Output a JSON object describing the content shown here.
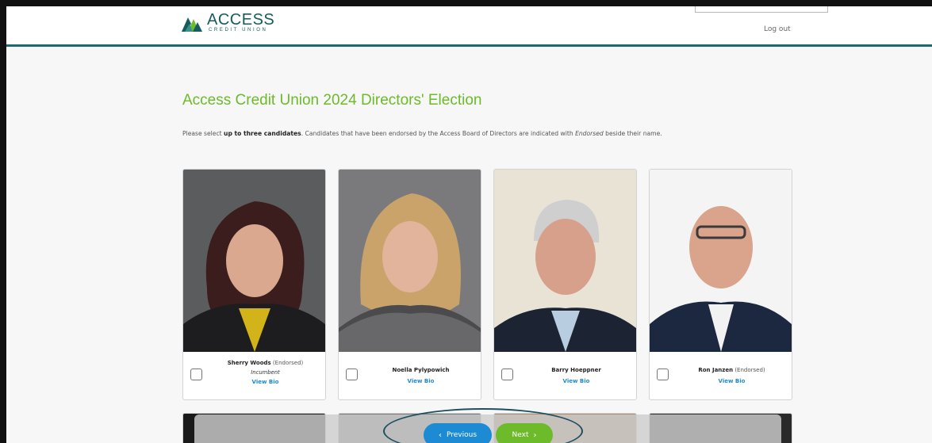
{
  "header": {
    "logo_word": "ACCESS",
    "logo_sub": "CREDIT UNION",
    "logout": "Log out"
  },
  "page": {
    "title": "Access Credit Union 2024 Directors' Election",
    "instructions_pre": "Please select ",
    "instructions_bold": "up to three candidates",
    "instructions_mid": ". Candidates that have been endorsed by the Access Board of Directors are indicated with ",
    "instructions_em": "Endorsed",
    "instructions_post": " beside their name."
  },
  "candidates": [
    {
      "name": "Sherry Woods",
      "endorsed": "(Endorsed)",
      "note": "Incumbent",
      "bio": "View Bio"
    },
    {
      "name": "Noella Pylypowich",
      "endorsed": "",
      "note": "",
      "bio": "View Bio"
    },
    {
      "name": "Barry Hoeppner",
      "endorsed": "",
      "note": "",
      "bio": "View Bio"
    },
    {
      "name": "Ron Janzen",
      "endorsed": "(Endorsed)",
      "note": "",
      "bio": "View Bio"
    }
  ],
  "nav": {
    "previous": "Previous",
    "next": "Next",
    "prev_icon": "chevron-left-icon",
    "next_icon": "chevron-right-icon"
  },
  "colors": {
    "brand_teal": "#155c5f",
    "title_green": "#6dba2b",
    "link_blue": "#1c8bd4",
    "previous_button": "#1c8bd4",
    "next_button": "#6dba2b",
    "highlight_ring": "#1d4f63"
  }
}
